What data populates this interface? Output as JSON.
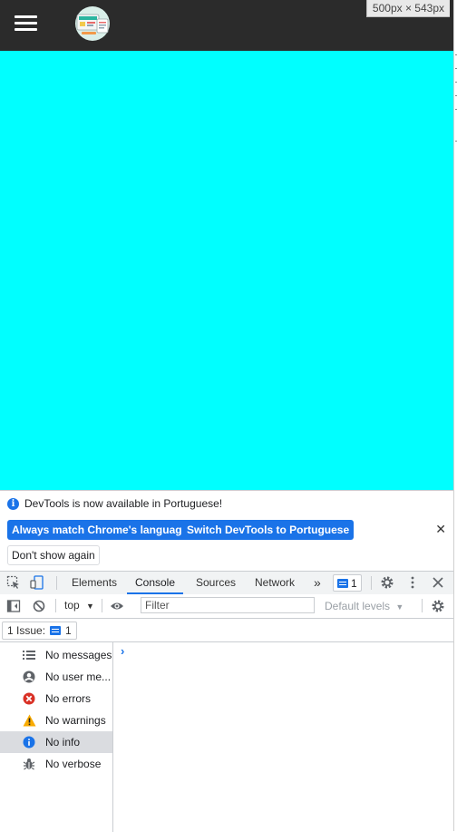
{
  "viewport": {
    "size_label": "500px × 543px",
    "background": "#00ffff",
    "header_background": "#2b2b2b"
  },
  "devtools": {
    "notice": {
      "text": "DevTools is now available in Portuguese!",
      "match_button": "Always match Chrome's language",
      "switch_button": "Switch DevTools to Portuguese",
      "dismiss_button": "Don't show again",
      "close_symbol": "✕"
    },
    "tabs": {
      "elements": "Elements",
      "console": "Console",
      "sources": "Sources",
      "network": "Network",
      "more": "»",
      "issue_count": "1"
    },
    "toolbar": {
      "context": "top",
      "filter_placeholder": "Filter",
      "levels": "Default levels"
    },
    "issues": {
      "label": "1 Issue:",
      "count": "1"
    },
    "sidebar": [
      {
        "label": "No messages",
        "icon": "list-icon"
      },
      {
        "label": "No user me...",
        "icon": "user-icon"
      },
      {
        "label": "No errors",
        "icon": "error-icon"
      },
      {
        "label": "No warnings",
        "icon": "warning-icon"
      },
      {
        "label": "No info",
        "icon": "info-icon",
        "selected": true
      },
      {
        "label": "No verbose",
        "icon": "bug-icon"
      }
    ],
    "prompt_symbol": "›",
    "accent_color": "#1a73e8"
  }
}
